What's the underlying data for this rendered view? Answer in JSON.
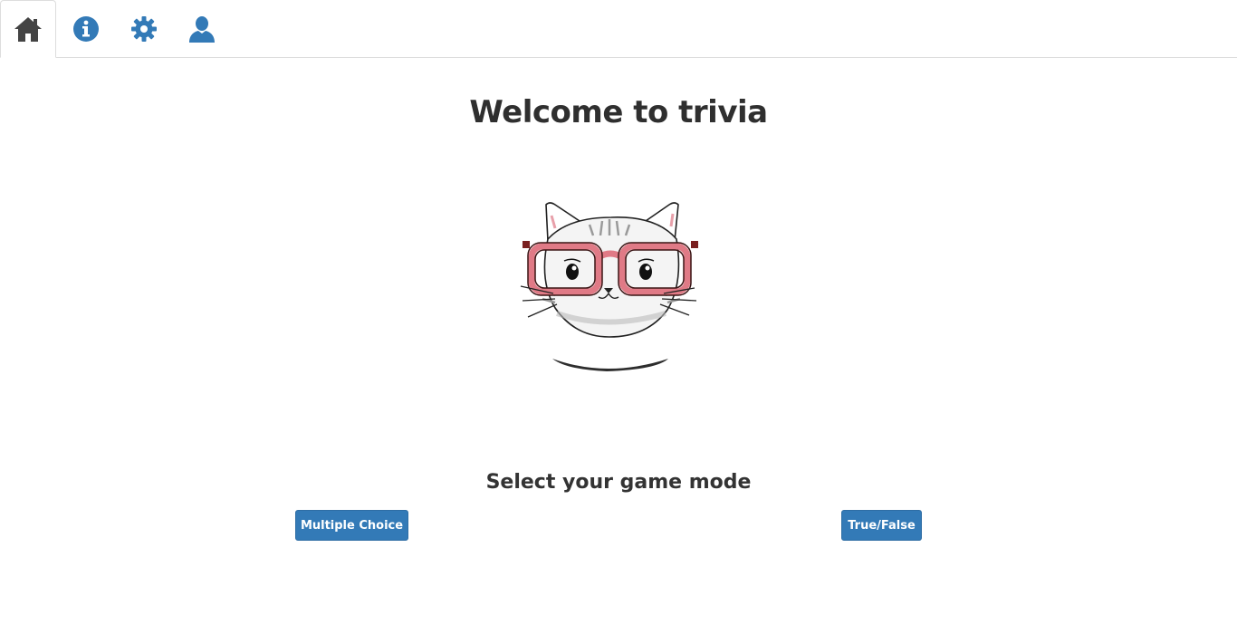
{
  "nav": {
    "tabs": [
      {
        "icon": "home-icon",
        "active": true
      },
      {
        "icon": "info-icon",
        "active": false
      },
      {
        "icon": "gear-icon",
        "active": false
      },
      {
        "icon": "user-icon",
        "active": false
      }
    ],
    "active_color": "#444444",
    "inactive_color": "#337ab7"
  },
  "main": {
    "title": "Welcome to trivia",
    "image": "cat-with-glasses-illustration",
    "subtitle": "Select your game mode",
    "modes": {
      "multiple_choice_label": "Multiple Choice",
      "true_false_label": "True/False"
    }
  },
  "colors": {
    "primary": "#337ab7",
    "text": "#333333",
    "glasses": "#e07a86"
  }
}
